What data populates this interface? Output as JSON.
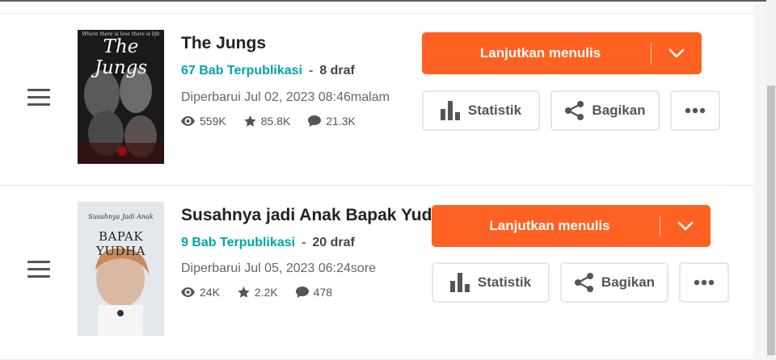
{
  "stories": [
    {
      "cover_text": [
        "Where there is love there is life",
        "The Jungs"
      ],
      "title": "The Jungs",
      "published": "67 Bab Terpublikasi",
      "separator": "-",
      "drafts": "8 draf",
      "updated": "Diperbarui Jul 02, 2023 08:46malam",
      "views": "559K",
      "votes": "85.8K",
      "comments": "21.3K",
      "continue_label": "Lanjutkan menulis",
      "stats_label": "Statistik",
      "share_label": "Bagikan"
    },
    {
      "cover_text": [
        "Susahnya Jadi Anak",
        "BAPAK YUDHA"
      ],
      "title": "Susahnya jadi Anak Bapak Yudha",
      "published": "9 Bab Terpublikasi",
      "separator": "-",
      "drafts": "20 draf",
      "updated": "Diperbarui Jul 05, 2023 06:24sore",
      "views": "24K",
      "votes": "2.2K",
      "comments": "478",
      "continue_label": "Lanjutkan menulis",
      "stats_label": "Statistik",
      "share_label": "Bagikan"
    }
  ],
  "colors": {
    "accent": "#ff6122",
    "published": "#00a6a6"
  },
  "icons": [
    "drag-handle-icon",
    "eye-icon",
    "star-icon",
    "comment-icon",
    "bar-chart-icon",
    "share-icon",
    "more-icon",
    "chevron-down-icon"
  ]
}
